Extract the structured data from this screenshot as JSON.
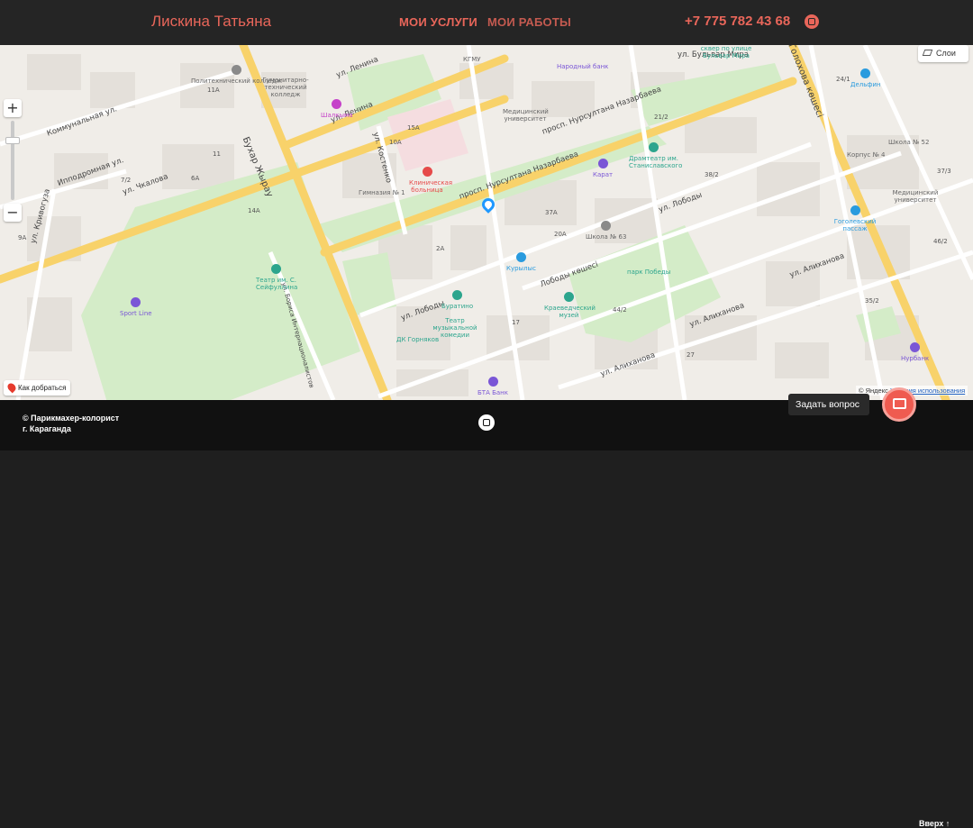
{
  "header": {
    "brand": "Лискина Татьяна",
    "nav": [
      {
        "label": "МОИ УСЛУГИ"
      },
      {
        "label": "МОИ РАБОТЫ"
      }
    ],
    "phone": "+7 775 782 43 68",
    "instagram_icon": "instagram-icon"
  },
  "map": {
    "zoom_in": "+",
    "zoom_out": "−",
    "layers_label": "Слои",
    "route_label": "Как добраться",
    "copyright_prefix": "© Яндекс",
    "copyright_link": "Условия использования",
    "streets": [
      "ул. Ленина",
      "ул. Ленина",
      "просп. Нурсултана Назарбаева",
      "просп. Нурсултана Назарбаева",
      "Бульвар Жыбек Жолы / Бухар Жырау даңғылы",
      "ул. Чкалова",
      "ул. Лободы",
      "ул. Лободы",
      "ул. Алиханова",
      "ул. Алиханова",
      "ул. Алиханова",
      "Лободы көшесі",
      "Коммунальная ул.",
      "Ипподромная ул.",
      "ул. Кривогуза",
      "ул. Костенко",
      "ул. Бульвар Мира",
      "Голоховa көшесі",
      "Бухар Жырау",
      "ул. Бориса Интернационалистов"
    ],
    "pois": [
      {
        "name": "Политехнический колледж",
        "color": "#8a8a8a"
      },
      {
        "name": "Гуманитарно-технический колледж",
        "color": "#8a8a8a"
      },
      {
        "name": "КГМУ",
        "color": "#8a8a8a"
      },
      {
        "name": "Народный банк",
        "color": "#7a56d6"
      },
      {
        "name": "Медицинский университет",
        "color": "#8a8a8a"
      },
      {
        "name": "Шалкыма",
        "color": "#c542c9"
      },
      {
        "name": "Клиническая больница",
        "color": "#e64a4a"
      },
      {
        "name": "Гимназия № 1",
        "color": "#8a8a8a"
      },
      {
        "name": "Карат",
        "color": "#7a56d6"
      },
      {
        "name": "Драмтеатр им. Станиславского",
        "color": "#2ca58d"
      },
      {
        "name": "Школа № 63",
        "color": "#8a8a8a"
      },
      {
        "name": "Театр им. С. Сейфуллина",
        "color": "#2ca58d"
      },
      {
        "name": "Sport Line",
        "color": "#7a56d6"
      },
      {
        "name": "Курылыс",
        "color": "#2a9bde"
      },
      {
        "name": "парк Победы",
        "color": "#2ca58d"
      },
      {
        "name": "Буратино",
        "color": "#2ca58d"
      },
      {
        "name": "Театр музыкальной комедии",
        "color": "#2ca58d"
      },
      {
        "name": "Краеведческий музей",
        "color": "#2ca58d"
      },
      {
        "name": "ДК Горняков",
        "color": "#2ca58d"
      },
      {
        "name": "БТА Банк",
        "color": "#7a56d6"
      },
      {
        "name": "Дельфин",
        "color": "#2a9bde"
      },
      {
        "name": "Школа № 52",
        "color": "#8a8a8a"
      },
      {
        "name": "Корпус № 4",
        "color": "#8a8a8a"
      },
      {
        "name": "Медицинский университет",
        "color": "#8a8a8a"
      },
      {
        "name": "Гоголевский пассаж",
        "color": "#2a9bde"
      },
      {
        "name": "Нурбанк",
        "color": "#7a56d6"
      },
      {
        "name": "сквер по улице Бульвар Мира",
        "color": "#2ca58d"
      }
    ],
    "house_numbers": [
      "11A",
      "15A",
      "10A",
      "11",
      "14A",
      "21/2",
      "37A",
      "20A",
      "9A",
      "2A",
      "6A",
      "7/2",
      "17",
      "44/2",
      "24/1",
      "37/3",
      "46/2",
      "35/2",
      "38/2",
      "27"
    ]
  },
  "footer": {
    "copy_line1": "© Парикмахер-колорист",
    "copy_line2": "г. Караганда",
    "instagram_icon": "instagram-icon",
    "ask_label": "Задать вопрос",
    "up_label": "Вверх ↑"
  }
}
